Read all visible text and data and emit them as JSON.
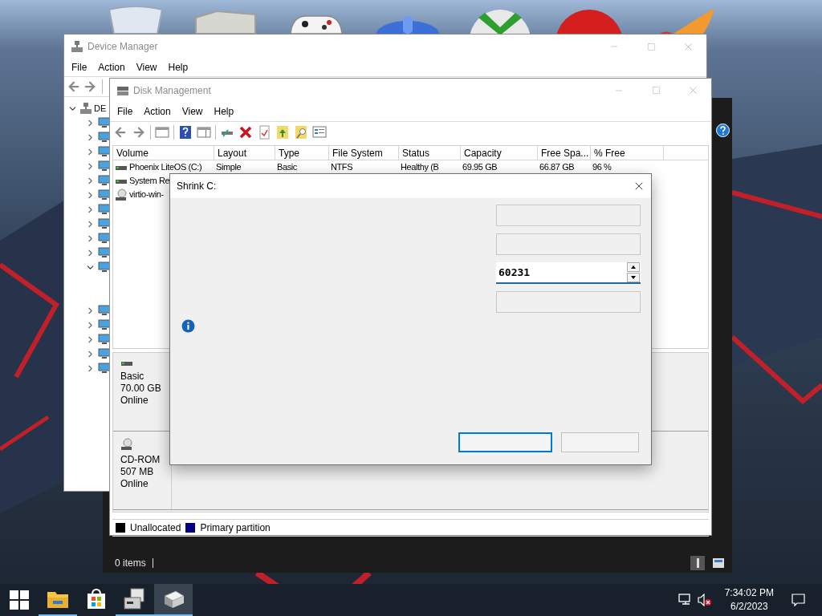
{
  "device_manager": {
    "title": "Device Manager",
    "menu": [
      "File",
      "Action",
      "View",
      "Help"
    ],
    "tree": {
      "label": "DE",
      "expanded": true,
      "children": [
        {
          "expanded": false
        },
        {
          "expanded": false
        },
        {
          "expanded": false
        },
        {
          "expanded": false
        },
        {
          "expanded": false
        },
        {
          "expanded": false
        },
        {
          "expanded": false
        },
        {
          "expanded": false
        },
        {
          "expanded": false
        },
        {
          "expanded": false
        },
        {
          "expanded": true
        },
        {
          "expanded": false
        },
        {
          "expanded": false
        },
        {
          "expanded": false
        },
        {
          "expanded": false
        },
        {
          "expanded": false
        }
      ]
    }
  },
  "back_window": {
    "status": "0 items"
  },
  "disk_management": {
    "title": "Disk Management",
    "menu": [
      "File",
      "Action",
      "View",
      "Help"
    ],
    "columns": [
      "Volume",
      "Layout",
      "Type",
      "File System",
      "Status",
      "Capacity",
      "Free Spa...",
      "% Free"
    ],
    "volumes": [
      {
        "kind": "disk",
        "cells": [
          "Phoenix LiteOS (C:)",
          "Simple",
          "Basic",
          "NTFS",
          "Healthy (B",
          "69.95 GB",
          "66.87 GB",
          "96 %"
        ]
      },
      {
        "kind": "disk",
        "cells": [
          "System Re"
        ]
      },
      {
        "kind": "cd",
        "cells": [
          "virtio-win-"
        ]
      }
    ],
    "disks": [
      {
        "kind": "disk",
        "lines": [
          "Basic",
          "70.00 GB",
          "Online"
        ]
      },
      {
        "kind": "cd",
        "lines": [
          "CD-ROM",
          "507 MB",
          "Online"
        ]
      }
    ],
    "legend": [
      {
        "label": "Unallocated",
        "color": "#000000"
      },
      {
        "label": "Primary partition",
        "color": "#000080"
      }
    ]
  },
  "dialog": {
    "title": "Shrink C:",
    "fields": [
      {
        "kind": "readonly"
      },
      {
        "kind": "readonly"
      },
      {
        "kind": "spin",
        "value": "60231"
      },
      {
        "kind": "readonly"
      }
    ],
    "buttons": [
      {
        "focused": true
      },
      {
        "focused": false
      }
    ]
  },
  "taskbar": {
    "apps": [
      {
        "kind": "start"
      },
      {
        "kind": "explorer",
        "running": true,
        "selected": false
      },
      {
        "kind": "store",
        "running": false,
        "selected": false
      },
      {
        "kind": "devmgr",
        "running": true,
        "selected": false
      },
      {
        "kind": "diskmgmt",
        "running": true,
        "selected": true
      }
    ],
    "volume_muted": true,
    "time": "7:34:02 PM",
    "date": "6/2/2023"
  }
}
